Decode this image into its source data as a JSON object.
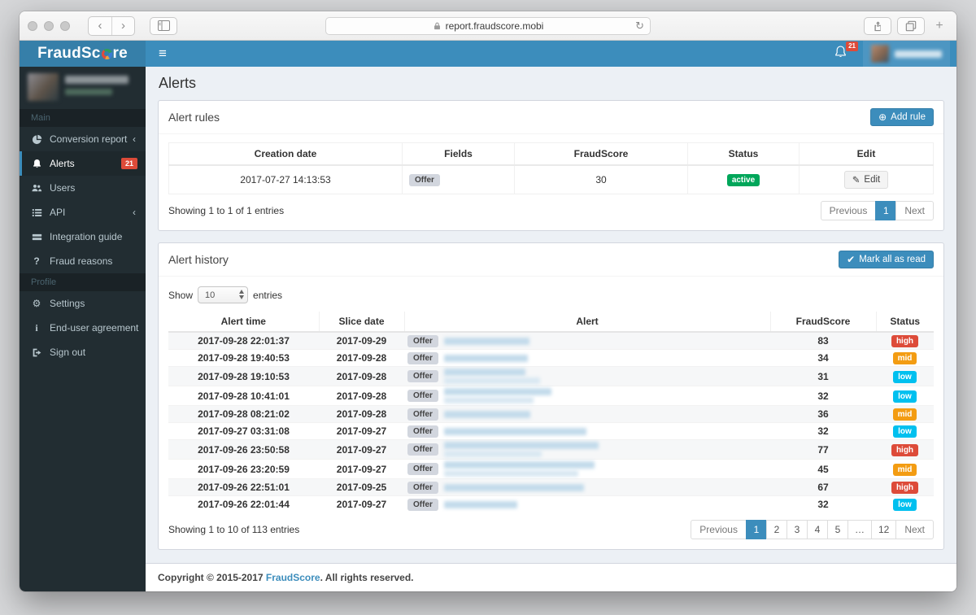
{
  "browser": {
    "url": "report.fraudscore.mobi",
    "back": "‹",
    "forward": "›",
    "reload": "↻",
    "new_tab": "+"
  },
  "header": {
    "logo_part1": "FraudSc",
    "logo_part2": "re",
    "menu_icon": "≡",
    "notifications_count": "21"
  },
  "sidebar": {
    "sections": [
      {
        "label": "Main",
        "items": [
          {
            "label": "Conversion report",
            "icon": "pie-chart-icon",
            "chevron": "‹"
          },
          {
            "label": "Alerts",
            "icon": "bell-icon",
            "badge": "21",
            "active": true
          },
          {
            "label": "Users",
            "icon": "users-icon"
          },
          {
            "label": "API",
            "icon": "list-icon",
            "chevron": "‹"
          },
          {
            "label": "Integration guide",
            "icon": "bars-icon"
          },
          {
            "label": "Fraud reasons",
            "icon": "question-icon",
            "glyph": "?"
          }
        ]
      },
      {
        "label": "Profile",
        "items": [
          {
            "label": "Settings",
            "icon": "gear-icon",
            "glyph": "⚙"
          },
          {
            "label": "End-user agreement",
            "icon": "info-icon",
            "glyph": "i"
          },
          {
            "label": "Sign out",
            "icon": "sign-out-icon"
          }
        ]
      }
    ]
  },
  "page": {
    "title": "Alerts"
  },
  "alert_rules": {
    "title": "Alert rules",
    "add_button": "Add rule",
    "add_icon": "⊕",
    "columns": [
      "Creation date",
      "Fields",
      "FraudScore",
      "Status",
      "Edit"
    ],
    "rows": [
      {
        "creation_date": "2017-07-27 14:13:53",
        "field": "Offer",
        "fraudscore": "30",
        "status": "active",
        "edit_label": "Edit",
        "edit_icon": "✎"
      }
    ],
    "summary": "Showing 1 to 1 of 1 entries",
    "pagination": {
      "prev": "Previous",
      "pages": [
        "1"
      ],
      "active": "1",
      "next": "Next"
    }
  },
  "alert_history": {
    "title": "Alert history",
    "mark_button": "Mark all as read",
    "mark_icon": "✔",
    "show_label": "Show",
    "show_value": "10",
    "entries_label": "entries",
    "columns": [
      "Alert time",
      "Slice date",
      "Alert",
      "FraudScore",
      "Status"
    ],
    "rows": [
      {
        "alert_time": "2017-09-28 22:01:37",
        "slice_date": "2017-09-29",
        "field": "Offer",
        "redact_w": 105,
        "redact_w2": 0,
        "fraudscore": "83",
        "status": "high"
      },
      {
        "alert_time": "2017-09-28 19:40:53",
        "slice_date": "2017-09-28",
        "field": "Offer",
        "redact_w": 103,
        "redact_w2": 0,
        "fraudscore": "34",
        "status": "mid"
      },
      {
        "alert_time": "2017-09-28 19:10:53",
        "slice_date": "2017-09-28",
        "field": "Offer",
        "redact_w": 100,
        "redact_w2": 118,
        "fraudscore": "31",
        "status": "low"
      },
      {
        "alert_time": "2017-09-28 10:41:01",
        "slice_date": "2017-09-28",
        "field": "Offer",
        "redact_w": 132,
        "redact_w2": 110,
        "fraudscore": "32",
        "status": "low"
      },
      {
        "alert_time": "2017-09-28 08:21:02",
        "slice_date": "2017-09-28",
        "field": "Offer",
        "redact_w": 106,
        "redact_w2": 0,
        "fraudscore": "36",
        "status": "mid"
      },
      {
        "alert_time": "2017-09-27 03:31:08",
        "slice_date": "2017-09-27",
        "field": "Offer",
        "redact_w": 175,
        "redact_w2": 0,
        "fraudscore": "32",
        "status": "low"
      },
      {
        "alert_time": "2017-09-26 23:50:58",
        "slice_date": "2017-09-27",
        "field": "Offer",
        "redact_w": 190,
        "redact_w2": 120,
        "fraudscore": "77",
        "status": "high"
      },
      {
        "alert_time": "2017-09-26 23:20:59",
        "slice_date": "2017-09-27",
        "field": "Offer",
        "redact_w": 185,
        "redact_w2": 165,
        "fraudscore": "45",
        "status": "mid"
      },
      {
        "alert_time": "2017-09-26 22:51:01",
        "slice_date": "2017-09-25",
        "field": "Offer",
        "redact_w": 172,
        "redact_w2": 0,
        "fraudscore": "67",
        "status": "high"
      },
      {
        "alert_time": "2017-09-26 22:01:44",
        "slice_date": "2017-09-27",
        "field": "Offer",
        "redact_w": 90,
        "redact_w2": 0,
        "fraudscore": "32",
        "status": "low"
      }
    ],
    "summary": "Showing 1 to 10 of 113 entries",
    "pagination": {
      "prev": "Previous",
      "pages": [
        "1",
        "2",
        "3",
        "4",
        "5",
        "…",
        "12"
      ],
      "active": "1",
      "next": "Next"
    }
  },
  "footer": {
    "text_before": "Copyright © 2015-2017 ",
    "brand": "FraudScore",
    "text_after": ". All rights reserved."
  },
  "colors": {
    "navbar": "#3c8dbc",
    "logo_bg": "#367fa9",
    "sidebar": "#222d32",
    "status_active": "#00a65a",
    "status_high": "#dd4b39",
    "status_mid": "#f39c12",
    "status_low": "#00c0ef",
    "danger_badge": "#dd4b39",
    "content_bg": "#ecf0f5"
  }
}
